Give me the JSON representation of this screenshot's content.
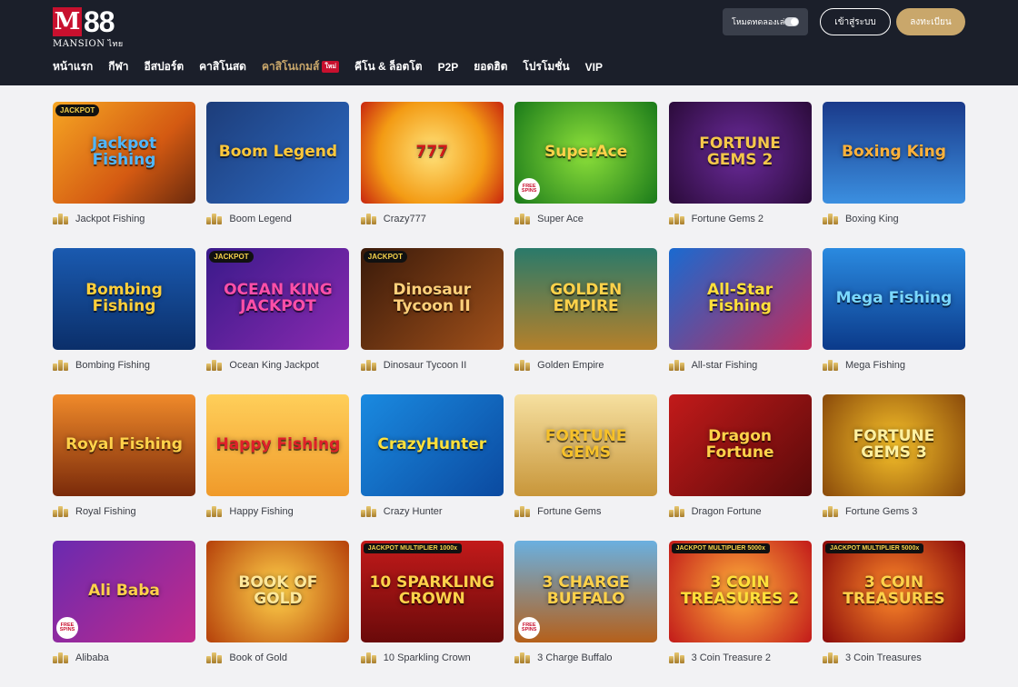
{
  "brand": {
    "name": "88",
    "sub": "MANSION",
    "sub_thai": "ไทย"
  },
  "nav": [
    {
      "label": "หน้าแรก",
      "active": false
    },
    {
      "label": "กีฬา",
      "active": false
    },
    {
      "label": "อีสปอร์ต",
      "active": false
    },
    {
      "label": "คาสิโนสด",
      "active": false
    },
    {
      "label": "คาสิโนเกมส์",
      "active": true,
      "badge": "ใหม่"
    },
    {
      "label": "คีโน & ล็อตโต",
      "active": false
    },
    {
      "label": "P2P",
      "active": false
    },
    {
      "label": "ยอดฮิต",
      "active": false
    },
    {
      "label": "โปรโมชั่น",
      "active": false
    },
    {
      "label": "VIP",
      "active": false
    }
  ],
  "header": {
    "demo_mode_label": "โหมดทดลองเล่น",
    "demo_mode_on": false,
    "login_label": "เข้าสู่ระบบ",
    "register_label": "ลงทะเบียน"
  },
  "colors": {
    "header_bg": "#1b1f2a",
    "accent_gold": "#c9a76b",
    "page_bg": "#f2f2f4"
  },
  "games": [
    {
      "name": "Jackpot Fishing",
      "thumb_text": "Jackpot Fishing",
      "tag": "JACKPOT",
      "bg": "linear-gradient(135deg,#f6a623,#d45a12 60,#6b2a0d)",
      "fg": "#4fb7ff"
    },
    {
      "name": "Boom Legend",
      "thumb_text": "Boom Legend",
      "bg": "linear-gradient(135deg,#1d3d7a,#2d6bc4)",
      "fg": "#ffc83a"
    },
    {
      "name": "Crazy777",
      "thumb_text": "777",
      "bg": "radial-gradient(circle,#ffe27a,#f39b14 60%,#c8250f)",
      "fg": "#d11a1a"
    },
    {
      "name": "Super Ace",
      "thumb_text": "SuperAce",
      "free": "FREE SPINS",
      "bg": "radial-gradient(circle,#8de03a,#1a7a1a)",
      "fg": "#ffd24a"
    },
    {
      "name": "Fortune Gems 2",
      "thumb_text": "FORTUNE GEMS 2",
      "bg": "radial-gradient(circle,#6a2a9a,#2b0b3a)",
      "fg": "#f4c74a"
    },
    {
      "name": "Boxing King",
      "thumb_text": "Boxing King",
      "bg": "linear-gradient(180deg,#1a3a8a,#3b8fe0)",
      "fg": "#ffb23a"
    },
    {
      "name": "Bombing Fishing",
      "thumb_text": "Bombing Fishing",
      "bg": "linear-gradient(180deg,#1a5ab0,#0b2f6a)",
      "fg": "#ffcf3a"
    },
    {
      "name": "Ocean King Jackpot",
      "thumb_text": "OCEAN KING JACKPOT",
      "tag": "JACKPOT",
      "bg": "linear-gradient(135deg,#3a1a8a,#8a2ab0)",
      "fg": "#ff4fa8"
    },
    {
      "name": "Dinosaur Tycoon II",
      "thumb_text": "Dinosaur Tycoon II",
      "tag": "JACKPOT",
      "bg": "linear-gradient(135deg,#3a1a0a,#a0501a)",
      "fg": "#ffd07a"
    },
    {
      "name": "Golden Empire",
      "thumb_text": "GOLDEN EMPIRE",
      "bg": "linear-gradient(180deg,#2a7a6a,#b5802a)",
      "fg": "#ffd24a"
    },
    {
      "name": "All-star Fishing",
      "thumb_text": "All-Star Fishing",
      "bg": "linear-gradient(135deg,#1a6ad0,#c22a5a)",
      "fg": "#ffe03a"
    },
    {
      "name": "Mega Fishing",
      "thumb_text": "Mega Fishing",
      "bg": "linear-gradient(180deg,#2a8ae0,#0b3a8a)",
      "fg": "#7ad8ff"
    },
    {
      "name": "Royal Fishing",
      "thumb_text": "Royal Fishing",
      "bg": "linear-gradient(180deg,#f08a2a,#7a2a0a)",
      "fg": "#ffd24a"
    },
    {
      "name": "Happy Fishing",
      "thumb_text": "Happy Fishing",
      "bg": "linear-gradient(180deg,#ffcf5a,#f09a2a)",
      "fg": "#e0202a"
    },
    {
      "name": "Crazy Hunter",
      "thumb_text": "CrazyHunter",
      "bg": "linear-gradient(135deg,#1a8ae0,#0b4aa0)",
      "fg": "#ffe03a"
    },
    {
      "name": "Fortune Gems",
      "thumb_text": "FORTUNE GEMS",
      "bg": "linear-gradient(180deg,#f6e0a0,#c8963a)",
      "fg": "#f6c12a"
    },
    {
      "name": "Dragon Fortune",
      "thumb_text": "Dragon Fortune",
      "bg": "linear-gradient(135deg,#c21a1a,#5a0a0a)",
      "fg": "#ffd24a"
    },
    {
      "name": "Fortune Gems 3",
      "thumb_text": "FORTUNE GEMS 3",
      "bg": "radial-gradient(circle,#f6c12a,#8a4a0a)",
      "fg": "#fff1a0"
    },
    {
      "name": "Alibaba",
      "thumb_text": "Ali Baba",
      "free": "FREE SPINS",
      "bg": "linear-gradient(135deg,#6a2ab0,#c22a8a)",
      "fg": "#ffd24a"
    },
    {
      "name": "Book of Gold",
      "thumb_text": "BOOK OF GOLD",
      "bg": "radial-gradient(circle,#ffd24a,#b5400a)",
      "fg": "#ffe89a"
    },
    {
      "name": "10 Sparkling Crown",
      "thumb_text": "10 SPARKLING CROWN",
      "tag_multi": "JACKPOT MULTIPLIER 1000x",
      "bg": "linear-gradient(180deg,#c21a1a,#6a0a0a)",
      "fg": "#ffd24a"
    },
    {
      "name": "3 Charge Buffalo",
      "thumb_text": "3 CHARGE BUFFALO",
      "free": "FREE SPINS",
      "bg": "linear-gradient(180deg,#6ab0e0,#b5601a)",
      "fg": "#ffd24a"
    },
    {
      "name": "3 Coin Treasure 2",
      "thumb_text": "3 COIN TREASURES 2",
      "tag_multi": "JACKPOT MULTIPLIER 5000x",
      "bg": "radial-gradient(circle,#ffb23a,#c21a1a)",
      "fg": "#ffe03a"
    },
    {
      "name": "3 Coin Treasures",
      "thumb_text": "3 COIN TREASURES",
      "tag_multi": "JACKPOT MULTIPLIER 5000x",
      "bg": "radial-gradient(circle,#ff8a2a,#8a0a0a)",
      "fg": "#ffd24a"
    }
  ]
}
